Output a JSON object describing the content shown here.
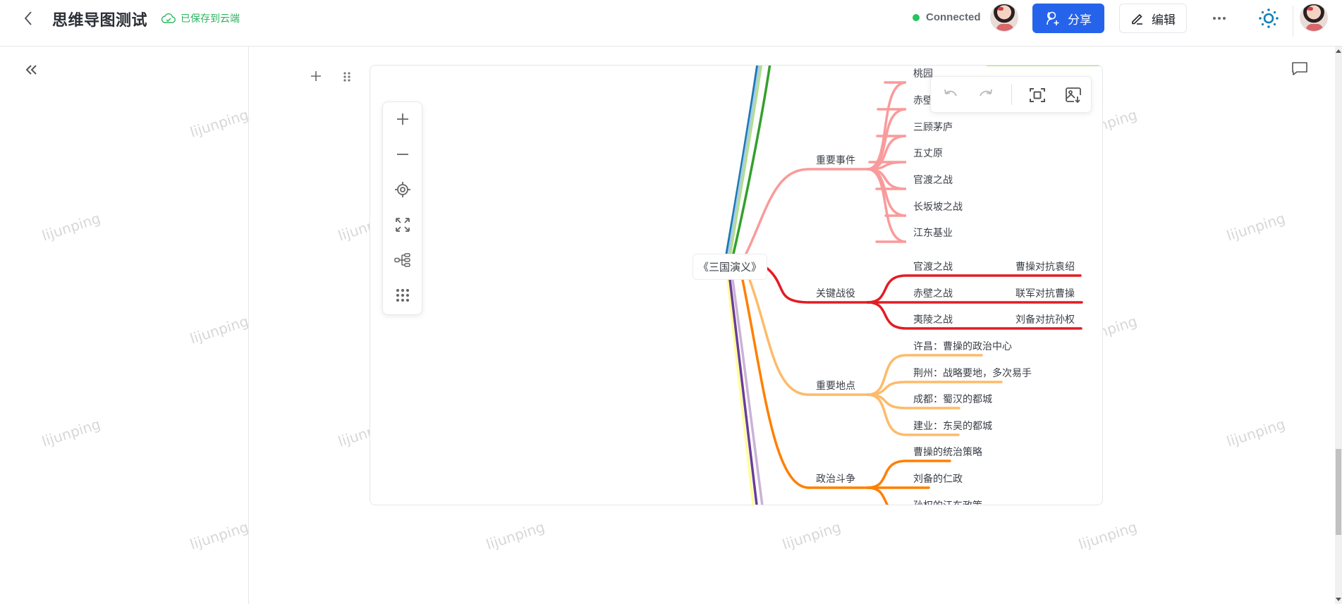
{
  "header": {
    "title": "思维导图测试",
    "save_status": "已保存到云端",
    "connection_status": "Connected",
    "share_label": "分享",
    "edit_label": "编辑"
  },
  "colors": {
    "accent": "#2563eb",
    "saved_green": "#2cb55f",
    "connected_green": "#22c55e",
    "theme_icon": "#0e7fb8"
  },
  "watermark": "lijunping",
  "mindmap": {
    "root": "《三国演义》",
    "branches": [
      {
        "label": "重要事件",
        "color": "#f99b9b",
        "children": [
          "桃园结义",
          "赤壁之战",
          "三顾茅庐",
          "五丈原",
          "官渡之战",
          "长坂坡之战",
          "江东基业"
        ],
        "visible_children": [
          "桃园",
          "赤壁",
          "三顾茅庐",
          "五丈原",
          "官渡之战",
          "长坂坡之战",
          "江东基业"
        ]
      },
      {
        "label": "关键战役",
        "color": "#e11d24",
        "children": [
          {
            "label": "官渡之战",
            "detail": "曹操对抗袁绍"
          },
          {
            "label": "赤壁之战",
            "detail": "联军对抗曹操"
          },
          {
            "label": "夷陵之战",
            "detail": "刘备对抗孙权"
          }
        ]
      },
      {
        "label": "重要地点",
        "color": "#fdbb6b",
        "children": [
          "许昌：曹操的政治中心",
          "荆州：战略要地，多次易手",
          "成都：蜀汉的都城",
          "建业：东吴的都城"
        ]
      },
      {
        "label": "政治斗争",
        "color": "#ff7f00",
        "children": [
          "曹操的统治策略",
          "刘备的仁政",
          "孙权的江东政策"
        ]
      }
    ],
    "offscreen_branch_colors": [
      "#1f78b4",
      "#a6cee3",
      "#b2df8a",
      "#33a02c",
      "#ffff99",
      "#6a3d9a",
      "#cab2d6"
    ]
  },
  "left_toolbar": [
    "zoom-in",
    "zoom-out",
    "locate-center",
    "fit-screen",
    "layout-structure",
    "more-grid"
  ],
  "top_toolbar": [
    "undo",
    "redo",
    "fit-view",
    "export-image"
  ]
}
